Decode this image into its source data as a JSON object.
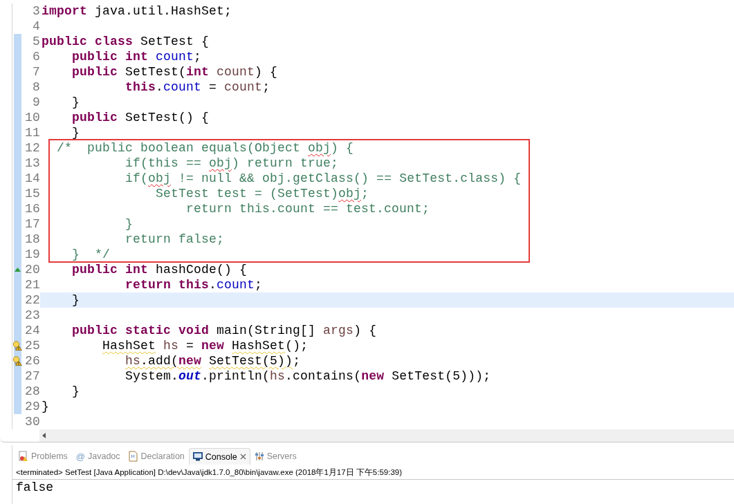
{
  "editor": {
    "sections": [
      {
        "boxed": false,
        "lines": [
          {
            "number": "3",
            "changed": false,
            "highlighted": false,
            "tokens": [
              {
                "text": "import",
                "kind": "keyword"
              },
              {
                "text": " java.util.HashSet;",
                "kind": "plain"
              }
            ]
          },
          {
            "number": "4",
            "changed": false,
            "highlighted": false
          },
          {
            "number": "5",
            "changed": true,
            "highlighted": false,
            "tokens": [
              {
                "text": "public class",
                "kind": "keyword"
              },
              {
                "text": " SetTest {",
                "kind": "plain"
              }
            ]
          },
          {
            "number": "6",
            "changed": true,
            "highlighted": false,
            "tokens": [
              {
                "text": "    public int ",
                "kind": "keyword"
              },
              {
                "text": "count",
                "kind": "field"
              },
              {
                "text": ";",
                "kind": "plain"
              }
            ]
          },
          {
            "number": "7",
            "changed": true,
            "highlighted": false,
            "tokens": [
              {
                "text": "    public",
                "kind": "keyword"
              },
              {
                "text": " SetTest(",
                "kind": "plain"
              },
              {
                "text": "int ",
                "kind": "keyword"
              },
              {
                "text": "count",
                "kind": "param"
              },
              {
                "text": ") {",
                "kind": "plain"
              }
            ]
          },
          {
            "number": "8",
            "changed": true,
            "highlighted": false,
            "tokens": [
              {
                "text": "           this",
                "kind": "keyword"
              },
              {
                "text": ".",
                "kind": "plain"
              },
              {
                "text": "count",
                "kind": "field"
              },
              {
                "text": " = ",
                "kind": "plain"
              },
              {
                "text": "count",
                "kind": "param"
              },
              {
                "text": ";",
                "kind": "plain"
              }
            ]
          },
          {
            "number": "9",
            "changed": true,
            "highlighted": false,
            "tokens": [
              {
                "text": "    }",
                "kind": "plain"
              }
            ]
          },
          {
            "number": "10",
            "changed": true,
            "highlighted": false,
            "tokens": [
              {
                "text": "    public",
                "kind": "keyword"
              },
              {
                "text": " SetTest() {",
                "kind": "plain"
              }
            ]
          },
          {
            "number": "11",
            "changed": true,
            "highlighted": false,
            "tokens": [
              {
                "text": "    }",
                "kind": "plain"
              }
            ]
          }
        ]
      },
      {
        "boxed": true,
        "lines": [
          {
            "number": "12",
            "changed": true,
            "highlighted": false,
            "tokens": [
              {
                "text": "  /*  public boolean equals(Object ",
                "kind": "comment"
              },
              {
                "text": "obj",
                "kind": "comment",
                "spelling_error": true
              },
              {
                "text": ") {",
                "kind": "comment"
              }
            ]
          },
          {
            "number": "13",
            "changed": true,
            "highlighted": false,
            "tokens": [
              {
                "text": "           if(this == ",
                "kind": "comment"
              },
              {
                "text": "obj",
                "kind": "comment",
                "spelling_error": true
              },
              {
                "text": ") return true;",
                "kind": "comment"
              }
            ]
          },
          {
            "number": "14",
            "changed": true,
            "highlighted": false,
            "tokens": [
              {
                "text": "           if(",
                "kind": "comment"
              },
              {
                "text": "obj",
                "kind": "comment",
                "spelling_error": true
              },
              {
                "text": " != null && obj.getClass() == SetTest.class) {",
                "kind": "comment"
              }
            ]
          },
          {
            "number": "15",
            "changed": true,
            "highlighted": false,
            "tokens": [
              {
                "text": "               SetTest test = (SetTest)",
                "kind": "comment"
              },
              {
                "text": "obj",
                "kind": "comment",
                "spelling_error": true
              },
              {
                "text": ";",
                "kind": "comment"
              }
            ]
          },
          {
            "number": "16",
            "changed": true,
            "highlighted": false,
            "tokens": [
              {
                "text": "                   return this.count == test.count;",
                "kind": "comment"
              }
            ]
          },
          {
            "number": "17",
            "changed": true,
            "highlighted": false,
            "tokens": [
              {
                "text": "           }",
                "kind": "comment"
              }
            ]
          },
          {
            "number": "18",
            "changed": true,
            "highlighted": false,
            "tokens": [
              {
                "text": "           return false;",
                "kind": "comment"
              }
            ]
          },
          {
            "number": "19",
            "changed": true,
            "highlighted": false,
            "tokens": [
              {
                "text": "    }  */",
                "kind": "comment"
              }
            ]
          }
        ]
      },
      {
        "boxed": false,
        "lines": [
          {
            "number": "20",
            "changed": true,
            "highlighted": false,
            "override_marker": true,
            "tokens": [
              {
                "text": "    public int",
                "kind": "keyword"
              },
              {
                "text": " hashCode() {",
                "kind": "plain"
              }
            ]
          },
          {
            "number": "21",
            "changed": true,
            "highlighted": false,
            "tokens": [
              {
                "text": "           return this",
                "kind": "keyword"
              },
              {
                "text": ".",
                "kind": "plain"
              },
              {
                "text": "count",
                "kind": "field"
              },
              {
                "text": ";",
                "kind": "plain"
              }
            ]
          },
          {
            "number": "22",
            "changed": true,
            "highlighted": true,
            "tokens": [
              {
                "text": "    }",
                "kind": "plain"
              }
            ]
          },
          {
            "number": "23",
            "changed": true,
            "highlighted": false
          },
          {
            "number": "24",
            "changed": true,
            "highlighted": false,
            "tokens": [
              {
                "text": "    public static void",
                "kind": "keyword"
              },
              {
                "text": " main(String[] ",
                "kind": "plain"
              },
              {
                "text": "args",
                "kind": "param"
              },
              {
                "text": ") {",
                "kind": "plain"
              }
            ]
          },
          {
            "number": "25",
            "changed": true,
            "highlighted": false,
            "warning_marker": true,
            "tokens": [
              {
                "text": "        HashSet",
                "kind": "plain",
                "warning": true
              },
              {
                "text": " hs",
                "kind": "param"
              },
              {
                "text": " = ",
                "kind": "plain"
              },
              {
                "text": "new ",
                "kind": "keyword"
              },
              {
                "text": "HashSet",
                "kind": "plain",
                "warning": true
              },
              {
                "text": "();",
                "kind": "plain"
              }
            ]
          },
          {
            "number": "26",
            "changed": true,
            "highlighted": false,
            "warning_marker": true,
            "tokens": [
              {
                "text": "           hs",
                "kind": "param",
                "warning": true
              },
              {
                "text": ".add(",
                "kind": "plain",
                "warning": true
              },
              {
                "text": "new",
                "kind": "keyword",
                "warning": true
              },
              {
                "text": " SetTest(5))",
                "kind": "plain",
                "warning": true
              },
              {
                "text": ";",
                "kind": "plain"
              }
            ]
          },
          {
            "number": "27",
            "changed": true,
            "highlighted": false,
            "tokens": [
              {
                "text": "           System.",
                "kind": "plain"
              },
              {
                "text": "out",
                "kind": "static-field"
              },
              {
                "text": ".println(",
                "kind": "plain"
              },
              {
                "text": "hs",
                "kind": "param"
              },
              {
                "text": ".contains(",
                "kind": "plain"
              },
              {
                "text": "new",
                "kind": "keyword"
              },
              {
                "text": " SetTest(5)));",
                "kind": "plain"
              }
            ]
          },
          {
            "number": "28",
            "changed": true,
            "highlighted": false,
            "tokens": [
              {
                "text": "    }",
                "kind": "plain"
              }
            ]
          },
          {
            "number": "29",
            "changed": true,
            "highlighted": false,
            "tokens": [
              {
                "text": "}",
                "kind": "plain"
              }
            ]
          },
          {
            "number": "30",
            "changed": false,
            "highlighted": false
          }
        ]
      }
    ]
  },
  "panel": {
    "tabs": [
      {
        "label": "Problems",
        "kind": "problems",
        "selected": false,
        "closable": false
      },
      {
        "label": "Javadoc",
        "kind": "javadoc",
        "icon": "@",
        "selected": false,
        "closable": false
      },
      {
        "label": "Declaration",
        "kind": "declaration",
        "selected": false,
        "closable": false
      },
      {
        "label": "Console",
        "kind": "console",
        "selected": true,
        "closable": true
      },
      {
        "label": "Servers",
        "kind": "servers",
        "selected": false,
        "closable": false
      }
    ],
    "console_header": "<terminated> SetTest [Java Application] D:\\dev\\Java\\jdk1.7.0_80\\bin\\javaw.exe (2018年1月17日 下午5:59:39)",
    "output": "false"
  }
}
